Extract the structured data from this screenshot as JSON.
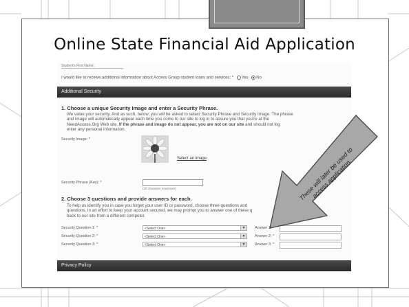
{
  "slide": {
    "title": "Online State Financial Aid Application",
    "arrow_note": "These will later be used to access application."
  },
  "screenshot": {
    "top_field_label": "Student's First Name:",
    "top_field_value": "",
    "info_question": "I would like to receive additional information about Access Group student loans and services: *",
    "info_yes": "Yes",
    "info_no": "No",
    "additional_security_header": "Additional Security",
    "step1_heading": "1. Choose a unique Security Image and enter a Security Phrase.",
    "step1_text_a": "We value your security. And as such, below, you will be asked to select Security Phrase and Security Image. The phrase",
    "step1_text_b": "and image will automatically appear each time you come to our site to log in to assure you that you're at the",
    "step1_text_c_normal": "NeedAccess.Org Web site. ",
    "step1_text_c_bold": "If the phrase and image do not appear, you are not on our site",
    "step1_text_c_tail": " and should not log",
    "step1_text_d": "enter any personal information.",
    "security_image_label": "Security Image: *",
    "select_image_link": "Select an image",
    "security_phrase_label": "Security Phrase (Key): *",
    "phrase_hint": "(20 character maximum)",
    "step2_heading": "2. Choose 3 questions and provide answers for each.",
    "step2_text_a": "To help us identify you in case you forget your user ID or password, choose three questions and",
    "step2_text_b": "questions. In an effort to keep your account secured, we may prompt you to answer one of these q",
    "step2_text_c": "back to our site from a different computer.",
    "questions": [
      {
        "label": "Security Question 1: *",
        "select": "<Select One>",
        "answer_label": "Answer 1: *"
      },
      {
        "label": "Security Question 2: *",
        "select": "<Select One>",
        "answer_label": "Answer 2: *"
      },
      {
        "label": "Security Question 3: *",
        "select": "<Select One>",
        "answer_label": "Answer 3: *"
      }
    ],
    "privacy_header": "Privacy Policy",
    "selected_info_option": "No"
  },
  "colors": {
    "dark_bar": "#333333",
    "arrow_fill": "#9a9a9a",
    "tab_fill": "#8a8a8a"
  }
}
